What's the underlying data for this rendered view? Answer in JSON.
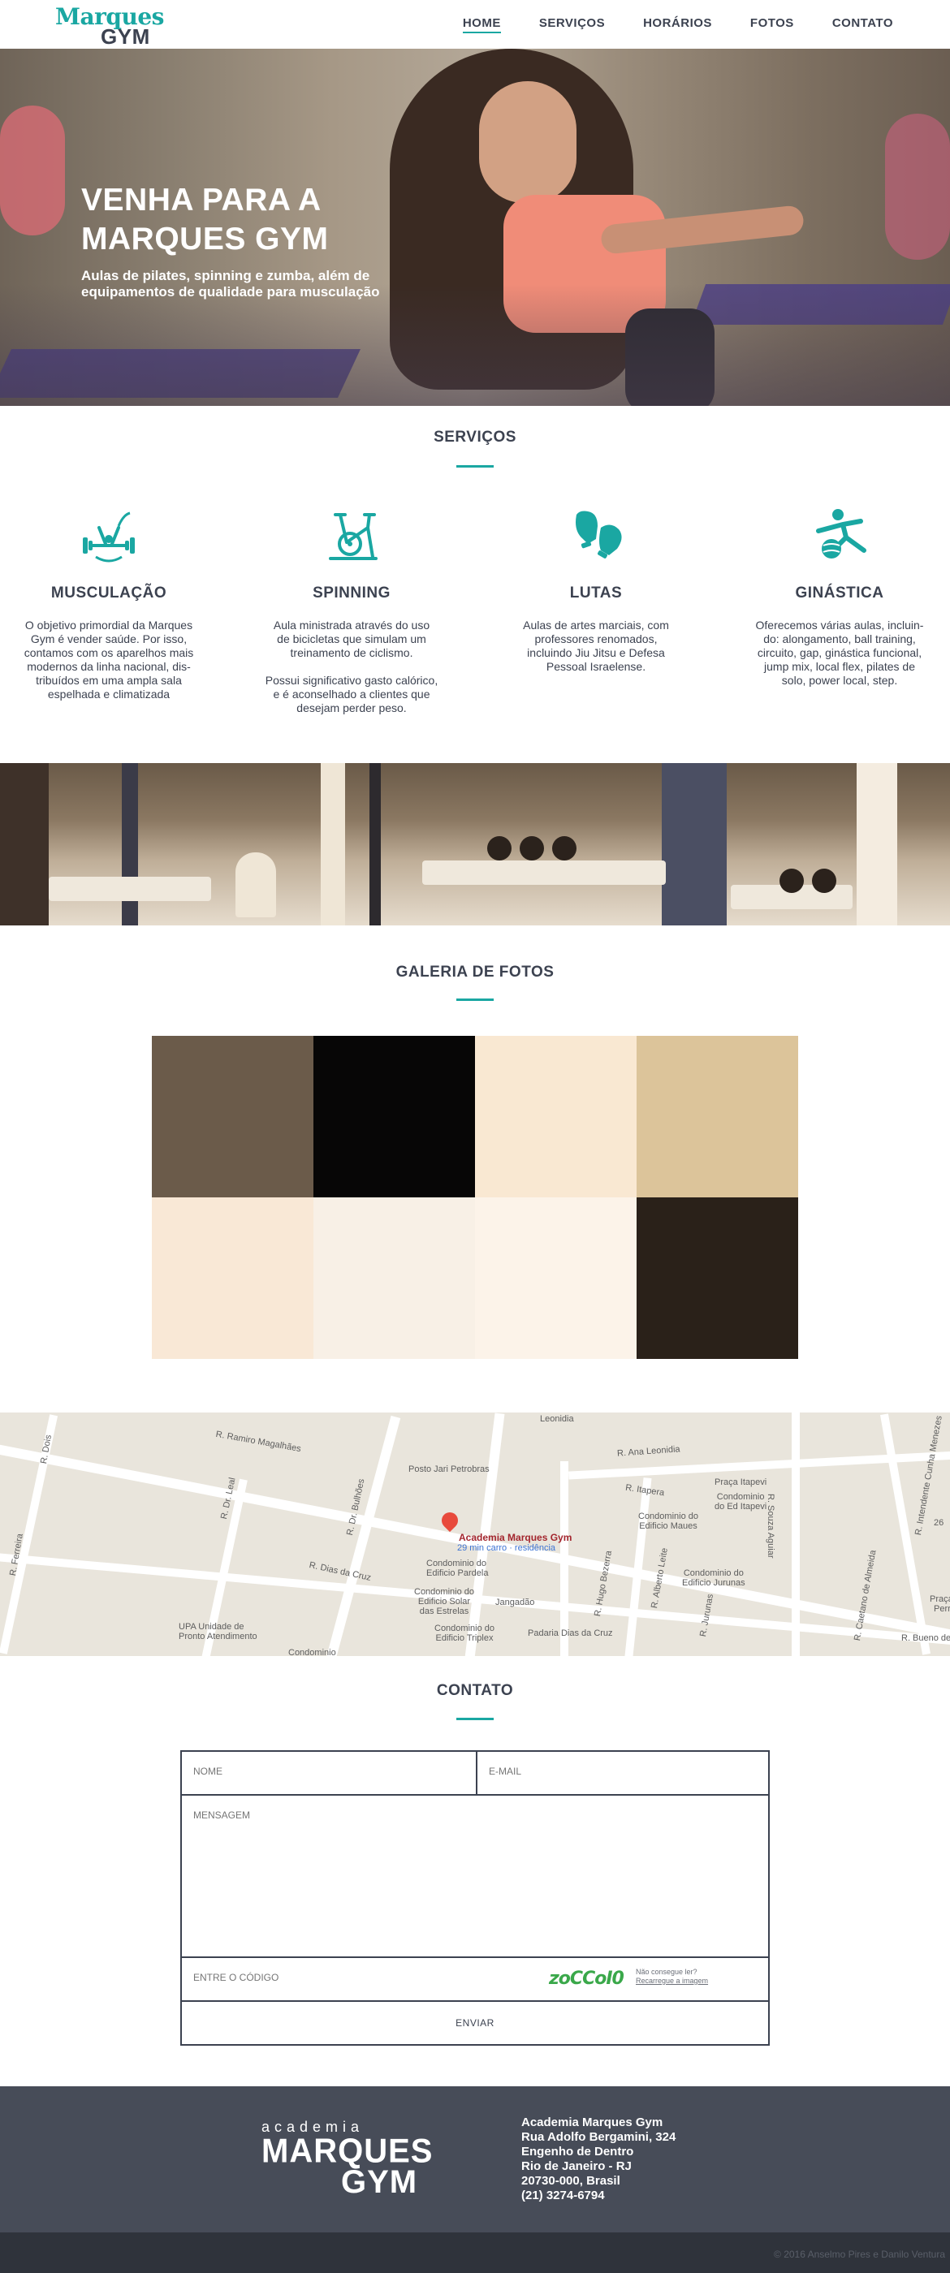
{
  "brand": {
    "logo_line1": "Marques",
    "logo_line2": "GYM",
    "accent_color": "#1aa7a2",
    "text_color": "#3c4250"
  },
  "nav": {
    "items": [
      {
        "label": "HOME",
        "active": true
      },
      {
        "label": "SERVIÇOS",
        "active": false
      },
      {
        "label": "HORÁRIOS",
        "active": false
      },
      {
        "label": "FOTOS",
        "active": false
      },
      {
        "label": "CONTATO",
        "active": false
      }
    ]
  },
  "hero": {
    "title_line1": "VENHA PARA A",
    "title_line2": "MARQUES GYM",
    "subtitle_line1": "Aulas de pilates, spinning e zumba, além de",
    "subtitle_line2": "equipamentos de qualidade para musculação"
  },
  "services": {
    "title": "SERVIÇOS",
    "items": [
      {
        "icon": "weightlifting-icon",
        "name": "MUSCULAÇÃO",
        "text": "O objetivo primordial da Marques\nGym é vender saúde. Por isso,\ncontamos com os aparelhos mais\nmodernos da linha nacional, dis-\ntribuídos em uma ampla sala\nespelhada e climatizada"
      },
      {
        "icon": "stationary-bike-icon",
        "name": "SPINNING",
        "text": "Aula ministrada através do uso\nde bicicletas que simulam um\ntreinamento de ciclismo.\n\nPossui significativo gasto calórico,\ne é aconselhado a clientes que\ndesejam perder peso."
      },
      {
        "icon": "boxing-gloves-icon",
        "name": "LUTAS",
        "text": "Aulas de artes marciais, com\nprofessores renomados,\nincluindo Jiu Jitsu e Defesa\nPessoal Israelense."
      },
      {
        "icon": "gymnastics-ball-icon",
        "name": "GINÁSTICA",
        "text": "Oferecemos várias aulas, incluin-\ndo: alongamento, ball training,\ncircuito, gap, ginástica funcional,\njump mix, local flex, pilates de\nsolo, power local, step."
      }
    ]
  },
  "gallery": {
    "title": "GALERIA DE FOTOS",
    "colors": [
      "#6b5b4a",
      "#070606",
      "#f9e8d2",
      "#dcc49a",
      "#f9e8d6",
      "#f8f0e6",
      "#fcf3e9",
      "#2a2119"
    ]
  },
  "map": {
    "place_name": "Academia Marques Gym",
    "place_sub": "29 min carro · residência",
    "labels": {
      "ramiro": "R. Ramiro Magalhães",
      "posto": "Posto Jari Petrobras",
      "ana": "R. Ana Leonidia",
      "leonidia": "Leonidia",
      "praca": "Praça Itapevi",
      "itapevi": "Condominio\ndo Ed Itapevi",
      "itapera": "R. Itapera",
      "maues": "Condominio do\nEdificio Maues",
      "souza": "R. Souza Aguiar",
      "cunha": "R. Intendente Cunha Menezes",
      "leal": "R. Dr. Leal",
      "bulhoes": "R. Dr. Bulhões",
      "dias": "R. Dias da Cruz",
      "pardela": "Condominio do\nEdificio Pardela",
      "solar": "Condominio do\nEdificio Solar\ndas Estrelas",
      "jangadao": "Jangadão",
      "triplex": "Condominio do\nEdificio Triplex",
      "padaria": "Padaria Dias da Cruz",
      "jurunas_cond": "Condominio do\nEdificio Jurunas",
      "upa": "UPA Unidade de\nPronto Atendimento",
      "hugo": "R. Hugo Bezerra",
      "alberto": "R. Alberto Leite",
      "jurunas": "R. Jurunas",
      "caetano": "R. Caetano de Almeida",
      "bueno": "R. Bueno de",
      "dois": "R. Dois",
      "ferreira": "R. Ferreira",
      "num26": "26",
      "perr": "Perr",
      "praca2": "Praça",
      "condominio": "Condominio"
    }
  },
  "contact": {
    "title": "CONTATO",
    "name_placeholder": "NOME",
    "email_placeholder": "E-MAIL",
    "message_placeholder": "MENSAGEM",
    "code_placeholder": "ENTRE O CÓDIGO",
    "captcha_text": "zoCCoI0",
    "captcha_help1": "Não consegue ler?",
    "captcha_help2": "Recarregue a imagem",
    "send_label": "ENVIAR"
  },
  "footer": {
    "logo_small": "academia",
    "logo_big1": "MARQUES",
    "logo_big2": "GYM",
    "address": [
      "Academia Marques Gym",
      "Rua Adolfo Bergamini, 324",
      "Engenho de Dentro",
      "Rio de Janeiro - RJ",
      "20730-000, Brasil",
      "(21) 3274-6794"
    ],
    "copyright": "© 2016 Anselmo Pires e Danilo Ventura"
  }
}
